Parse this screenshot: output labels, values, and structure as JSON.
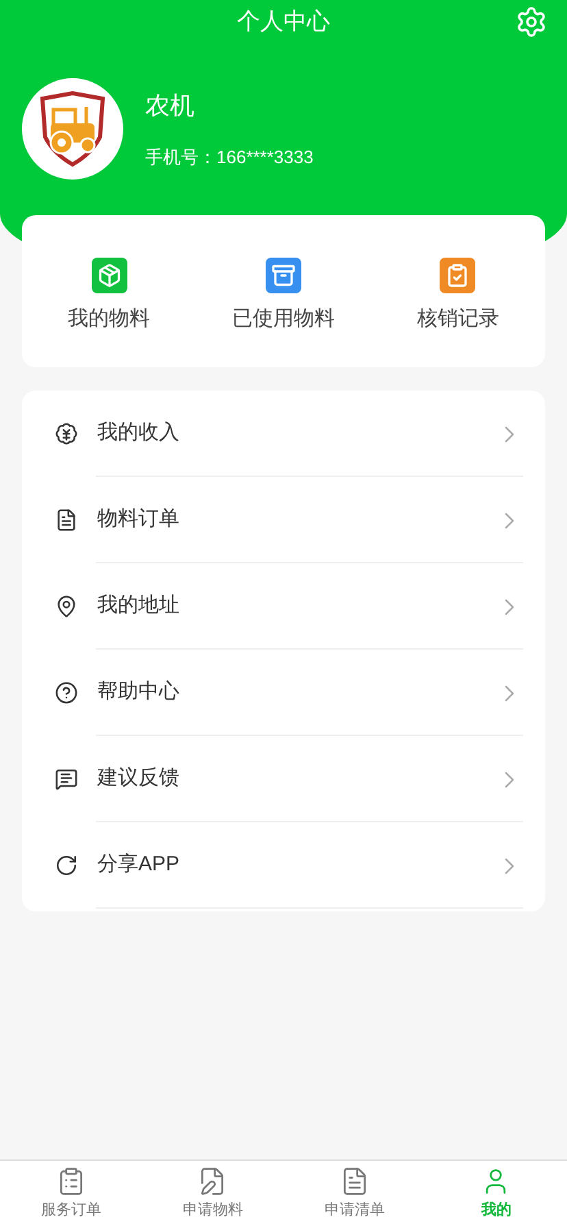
{
  "header": {
    "title": "个人中心"
  },
  "profile": {
    "name": "农机",
    "phone": "手机号：166****3333"
  },
  "shortcuts": [
    {
      "label": "我的物料"
    },
    {
      "label": "已使用物料"
    },
    {
      "label": "核销记录"
    }
  ],
  "menu": [
    {
      "label": "我的收入"
    },
    {
      "label": "物料订单"
    },
    {
      "label": "我的地址"
    },
    {
      "label": "帮助中心"
    },
    {
      "label": "建议反馈"
    },
    {
      "label": "分享APP"
    }
  ],
  "tab_bar": [
    {
      "label": "服务订单",
      "selected": false
    },
    {
      "label": "申请物料",
      "selected": false
    },
    {
      "label": "申请清单",
      "selected": false
    },
    {
      "label": "我的",
      "selected": true
    }
  ]
}
